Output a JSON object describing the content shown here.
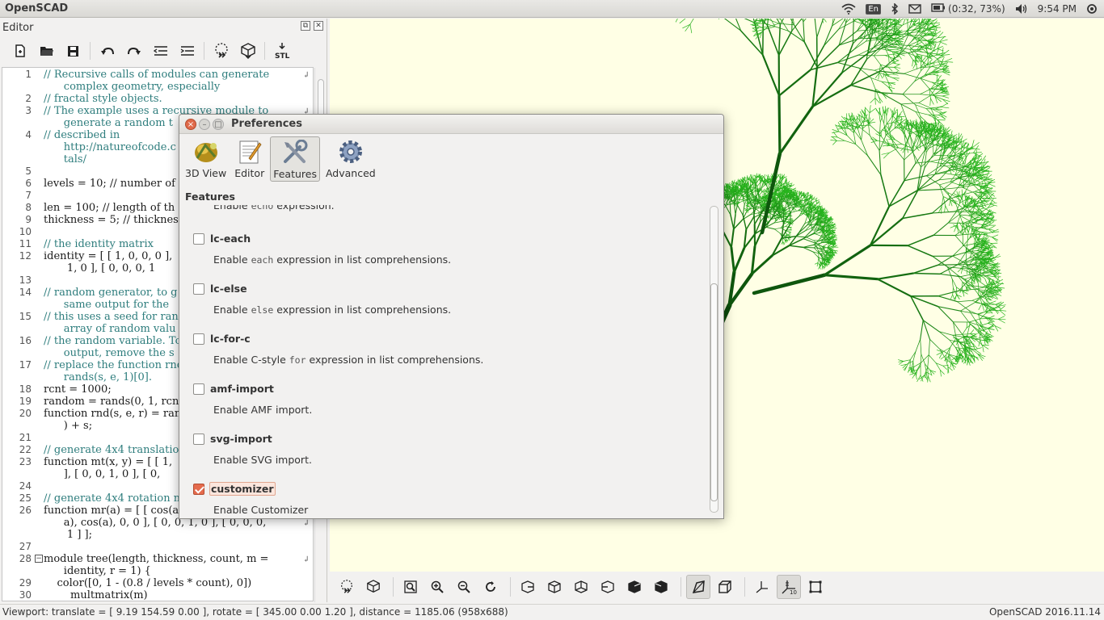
{
  "top_panel": {
    "app_title": "OpenSCAD",
    "keyboard_layout": "En",
    "battery": "(0:32, 73%)",
    "time": "9:54 PM"
  },
  "editor": {
    "title": "Editor",
    "toolbar_icons": [
      "new-file-icon",
      "open-file-icon",
      "save-icon",
      "undo-icon",
      "redo-icon",
      "unindent-icon",
      "indent-icon",
      "preview-icon",
      "render-icon",
      "export-stl-icon"
    ],
    "stl_label": "STL",
    "lines": [
      {
        "n": "1",
        "t": "// Recursive calls of modules can generate",
        "c": "cm",
        "wrap": true
      },
      {
        "n": "",
        "t": "      complex geometry, especially",
        "c": "cm"
      },
      {
        "n": "2",
        "t": "// fractal style objects.",
        "c": "cm"
      },
      {
        "n": "3",
        "t": "// The example uses a recursive module to",
        "c": "cm",
        "wrap": true
      },
      {
        "n": "",
        "t": "      generate a random t",
        "c": "cm"
      },
      {
        "n": "4",
        "t": "// described in",
        "c": "cm"
      },
      {
        "n": "",
        "t": "      http://natureofcode.c",
        "c": "cm"
      },
      {
        "n": "",
        "t": "      tals/",
        "c": "cm"
      },
      {
        "n": "5",
        "t": "",
        "c": ""
      },
      {
        "n": "6",
        "t": "levels = 10; // number of",
        "c": ""
      },
      {
        "n": "7",
        "t": "",
        "c": ""
      },
      {
        "n": "8",
        "t": "len = 100; // length of th",
        "c": ""
      },
      {
        "n": "9",
        "t": "thickness = 5; // thickness",
        "c": ""
      },
      {
        "n": "10",
        "t": "",
        "c": ""
      },
      {
        "n": "11",
        "t": "// the identity matrix",
        "c": "cm"
      },
      {
        "n": "12",
        "t": "identity = [ [ 1, 0, 0, 0 ],",
        "c": ""
      },
      {
        "n": "",
        "t": "       1, 0 ], [ 0, 0, 0, 1",
        "c": ""
      },
      {
        "n": "13",
        "t": "",
        "c": ""
      },
      {
        "n": "14",
        "t": "// random generator, to g",
        "c": "cm"
      },
      {
        "n": "",
        "t": "      same output for the",
        "c": "cm"
      },
      {
        "n": "15",
        "t": "// this uses a seed for ran",
        "c": "cm"
      },
      {
        "n": "",
        "t": "      array of random valu",
        "c": "cm"
      },
      {
        "n": "16",
        "t": "// the random variable. To",
        "c": "cm"
      },
      {
        "n": "",
        "t": "      output, remove the s",
        "c": "cm"
      },
      {
        "n": "17",
        "t": "// replace the function rnd",
        "c": "cm"
      },
      {
        "n": "",
        "t": "      rands(s, e, 1)[0].",
        "c": "cm"
      },
      {
        "n": "18",
        "t": "rcnt = 1000;",
        "c": ""
      },
      {
        "n": "19",
        "t": "random = rands(0, 1, rcnt",
        "c": ""
      },
      {
        "n": "20",
        "t": "function rnd(s, e, r) = ran",
        "c": ""
      },
      {
        "n": "",
        "t": "      ) + s;",
        "c": ""
      },
      {
        "n": "21",
        "t": "",
        "c": ""
      },
      {
        "n": "22",
        "t": "// generate 4x4 translation",
        "c": "cm"
      },
      {
        "n": "23",
        "t": "function mt(x, y) = [ [ 1, ",
        "c": ""
      },
      {
        "n": "",
        "t": "      ], [ 0, 0, 1, 0 ], [ 0,",
        "c": ""
      },
      {
        "n": "24",
        "t": "",
        "c": ""
      },
      {
        "n": "25",
        "t": "// generate 4x4 rotation m",
        "c": "cm"
      },
      {
        "n": "26",
        "t": "function mr(a) = [ [ cos(a)",
        "c": ""
      },
      {
        "n": "",
        "t": "      a), cos(a), 0, 0 ], [ 0, 0, 1, 0 ], [ 0, 0, 0,",
        "c": "",
        "wrap": true
      },
      {
        "n": "",
        "t": "       1 ] ];",
        "c": ""
      },
      {
        "n": "27",
        "t": "",
        "c": ""
      },
      {
        "n": "28",
        "t": "module tree(length, thickness, count, m =",
        "c": "",
        "wrap": true,
        "fold": true
      },
      {
        "n": "",
        "t": "      identity, r = 1) {",
        "c": ""
      },
      {
        "n": "29",
        "t": "    color([0, 1 - (0.8 / levels * count), 0])",
        "c": ""
      },
      {
        "n": "30",
        "t": "        multmatrix(m)",
        "c": ""
      }
    ]
  },
  "viewport_toolbar": [
    "preview-icon",
    "render-icon",
    "view-all-icon",
    "zoom-in-icon",
    "zoom-out-icon",
    "reset-view-icon",
    "view-right-icon",
    "view-top-icon",
    "view-bottom-icon",
    "view-left-icon",
    "view-front-icon",
    "view-back-icon",
    "perspective-icon",
    "orthogonal-icon",
    "show-axes-icon",
    "show-scale-markers-icon",
    "show-edges-icon"
  ],
  "status": {
    "viewport": "Viewport: translate = [ 9.19 154.59 0.00 ], rotate = [ 345.00 0.00 1.20 ], distance = 1185.06 (958x688)",
    "version": "OpenSCAD 2016.11.14"
  },
  "preferences": {
    "title": "Preferences",
    "tabs": [
      {
        "label": "3D View",
        "icon": "3d-view-icon",
        "active": false
      },
      {
        "label": "Editor",
        "icon": "editor-icon",
        "active": false
      },
      {
        "label": "Features",
        "icon": "features-icon",
        "active": true
      },
      {
        "label": "Advanced",
        "icon": "advanced-gear-icon",
        "active": false
      }
    ],
    "section_label": "Features",
    "cut_off_text": "Enable echo expression.",
    "features": [
      {
        "name": "lc-each",
        "checked": false,
        "desc_pre": "Enable ",
        "desc_code": "each",
        "desc_post": " expression in list comprehensions."
      },
      {
        "name": "lc-else",
        "checked": false,
        "desc_pre": "Enable ",
        "desc_code": "else",
        "desc_post": " expression in list comprehensions."
      },
      {
        "name": "lc-for-c",
        "checked": false,
        "desc_pre": "Enable C-style ",
        "desc_code": "for",
        "desc_post": " expression in list comprehensions."
      },
      {
        "name": "amf-import",
        "checked": false,
        "desc_pre": "Enable AMF import.",
        "desc_code": "",
        "desc_post": ""
      },
      {
        "name": "svg-import",
        "checked": false,
        "desc_pre": "Enable SVG import.",
        "desc_code": "",
        "desc_post": ""
      },
      {
        "name": "customizer",
        "checked": true,
        "desc_pre": "Enable Customizer",
        "desc_code": "",
        "desc_post": ""
      }
    ]
  },
  "colors": {
    "viewport_bg": "#ffffe5",
    "tree_dark": "#0b4a0b",
    "tree_light": "#22b022",
    "accent": "#e56b4d"
  }
}
